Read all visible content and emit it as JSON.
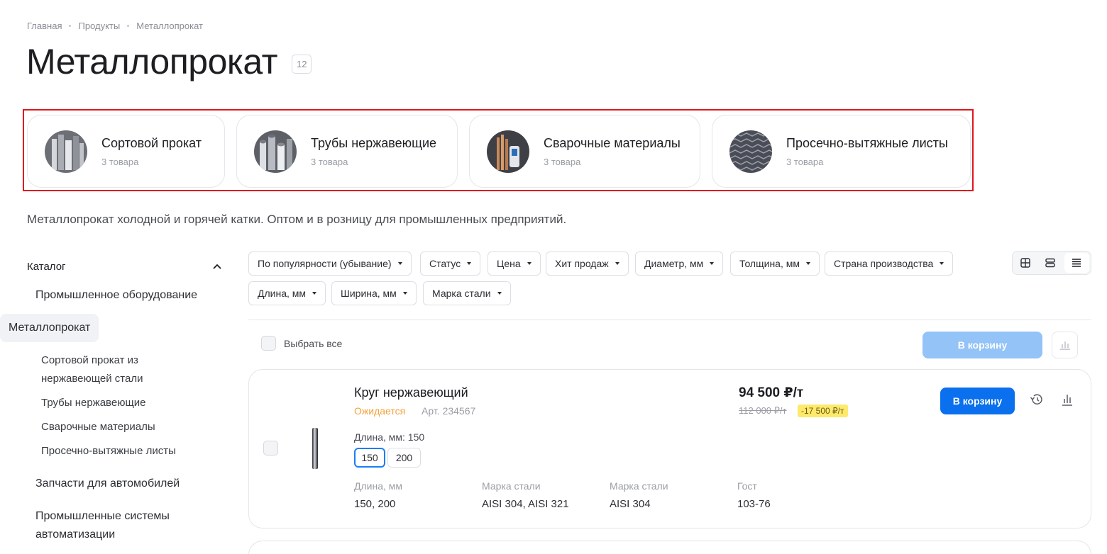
{
  "breadcrumb": [
    "Главная",
    "Продукты",
    "Металлопрокат"
  ],
  "page_title": "Металлопрокат",
  "product_count": "12",
  "categories": [
    {
      "name": "Сортовой прокат",
      "count": "3 товара"
    },
    {
      "name": "Трубы нержавеющие",
      "count": "3 товара"
    },
    {
      "name": "Сварочные материалы",
      "count": "3 товара"
    },
    {
      "name": "Просечно-вытяжные листы",
      "count": "3 товара"
    }
  ],
  "description": "Металлопрокат холодной и горячей катки. Оптом и в розницу для промышленных предприятий.",
  "sidebar": {
    "heading": "Каталог",
    "items": [
      "Промышленное оборудование",
      "Металлопрокат",
      "Запчасти для автомобилей",
      "Промышленные системы автоматизации"
    ],
    "subitems": [
      "Сортовой прокат из нержавеющей стали",
      "Трубы нержавеющие",
      "Сварочные материалы",
      "Просечно-вытяжные листы"
    ]
  },
  "filters": [
    "По популярности (убывание)",
    "Статус",
    "Цена",
    "Хит продаж",
    "Диаметр, мм",
    "Толщина, мм",
    "Страна производства",
    "Длина, мм",
    "Ширина, мм",
    "Марка стали"
  ],
  "list_controls": {
    "select_all": "Выбрать все",
    "bulk_cart": "В корзину"
  },
  "product": {
    "title": "Круг нержавеющий",
    "status": "Ожидается",
    "article_label": "Арт.",
    "article": "234567",
    "length_label": "Длина, мм: 150",
    "length_options": [
      "150",
      "200"
    ],
    "props": [
      {
        "name": "Длина, мм",
        "value": "150, 200"
      },
      {
        "name": "Марка стали",
        "value": "AISI 304, AISI 321"
      },
      {
        "name": "Марка стали",
        "value": "AISI 304"
      },
      {
        "name": "Гост",
        "value": "103-76"
      }
    ],
    "price": "94 500 ₽/т",
    "old_price": "112 000 ₽/т",
    "discount": "-17 500 ₽/т",
    "cart_label": "В корзину"
  },
  "colors": {
    "accent": "#0a70ee",
    "accent_disabled": "#93c3f7",
    "status_waiting": "#f5a23b",
    "discount_bg": "#fde96b",
    "highlight_frame": "#e0161d"
  }
}
